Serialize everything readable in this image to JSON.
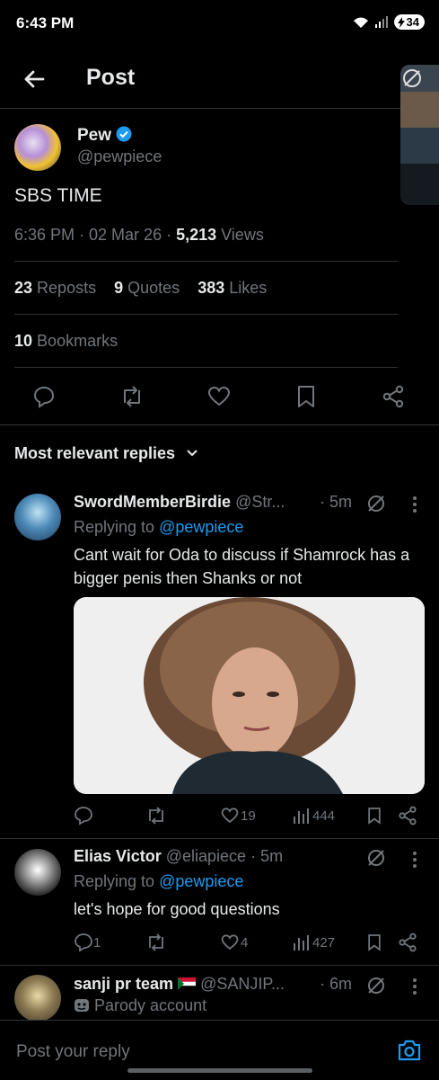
{
  "status_bar": {
    "time": "6:43 PM",
    "battery": "34"
  },
  "header": {
    "title": "Post"
  },
  "post": {
    "author_name": "Pew",
    "author_handle": "@pewpiece",
    "text": "SBS TIME",
    "timestamp": "6:36 PM · 02 Mar 26 · ",
    "views_count": "5,213",
    "views_label": " Views",
    "reposts_count": "23",
    "reposts_label": "Reposts",
    "quotes_count": "9",
    "quotes_label": "Quotes",
    "likes_count": "383",
    "likes_label": "Likes",
    "bookmarks_count": "10",
    "bookmarks_label": "Bookmarks"
  },
  "replies_sort": {
    "label": "Most relevant replies"
  },
  "replies": [
    {
      "name": "SwordMemberBirdie",
      "handle": "@Str...",
      "time": "· 5m",
      "replying_prefix": "Replying to ",
      "replying_to": "@pewpiece",
      "text": "Cant wait for Oda to discuss if Shamrock has a bigger penis then Shanks or not",
      "reply_count": "",
      "like_count": "19",
      "view_count": "444"
    },
    {
      "name": "Elias Victor",
      "handle": "@eliapiece",
      "time": "· 5m",
      "replying_prefix": "Replying to ",
      "replying_to": "@pewpiece",
      "text": "let's hope for good questions",
      "reply_count": "1",
      "like_count": "4",
      "view_count": "427"
    },
    {
      "name": "sanji pr team",
      "handle": "@SANJIP...",
      "time": "· 6m",
      "badge": "Parody account"
    }
  ],
  "composer": {
    "placeholder": "Post your reply"
  },
  "colors": {
    "accent": "#1d9bf0",
    "muted": "#71767b",
    "text": "#e7e9ea",
    "border": "#2f3336"
  }
}
